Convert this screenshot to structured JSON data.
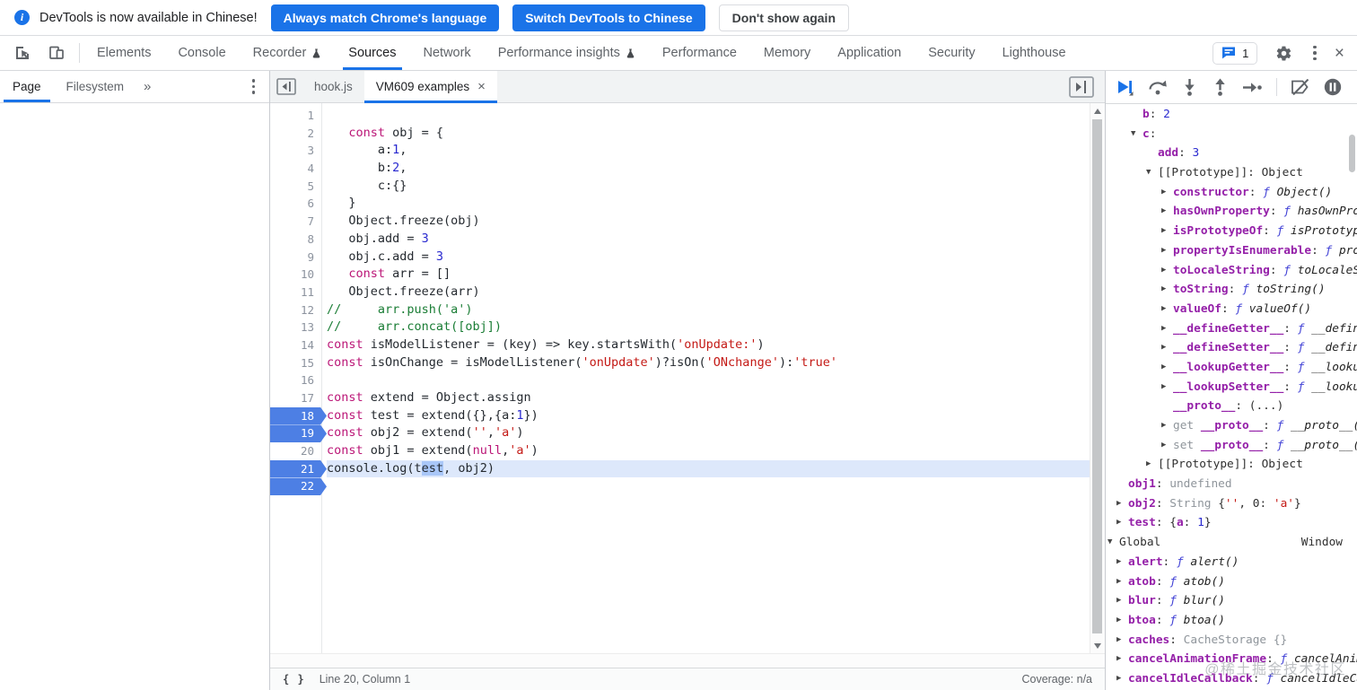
{
  "colors": {
    "accent": "#1a73e8",
    "breakpoint": "#4d7fe4",
    "keyword": "#bb1677",
    "number": "#2828cf",
    "string": "#c41a16",
    "comment": "#1a7d35",
    "property": "#941fa8",
    "current_line": "#dde8fb",
    "selection": "#a9c7f8",
    "icon_gray": "#5f6368"
  },
  "banner": {
    "message": "DevTools is now available in Chinese!",
    "buttons": [
      "Always match Chrome's language",
      "Switch DevTools to Chinese",
      "Don't show again"
    ]
  },
  "main_toolbar": {
    "tabs": [
      {
        "label": "Elements"
      },
      {
        "label": "Console"
      },
      {
        "label": "Recorder",
        "flask": true
      },
      {
        "label": "Sources",
        "active": true
      },
      {
        "label": "Network"
      },
      {
        "label": "Performance insights",
        "flask": true
      },
      {
        "label": "Performance"
      },
      {
        "label": "Memory"
      },
      {
        "label": "Application"
      },
      {
        "label": "Security"
      },
      {
        "label": "Lighthouse"
      }
    ],
    "issues_count": "1"
  },
  "navigator": {
    "tabs": [
      {
        "label": "Page",
        "active": true
      },
      {
        "label": "Filesystem"
      }
    ],
    "more_symbol": "»"
  },
  "editor": {
    "tabs": [
      {
        "label": "hook.js"
      },
      {
        "label": "VM609 examples",
        "active": true,
        "closable": true
      }
    ],
    "breakpoint_lines": [
      18,
      19,
      21,
      22
    ],
    "current_line": 21,
    "lines": [
      [],
      [
        [
          "d",
          "   "
        ],
        [
          "k",
          "const"
        ],
        [
          "d",
          " obj = {"
        ]
      ],
      [
        [
          "d",
          "       a:"
        ],
        [
          "n",
          "1"
        ],
        [
          "d",
          ","
        ]
      ],
      [
        [
          "d",
          "       b:"
        ],
        [
          "n",
          "2"
        ],
        [
          "d",
          ","
        ]
      ],
      [
        [
          "d",
          "       c:{}"
        ]
      ],
      [
        [
          "d",
          "   }"
        ]
      ],
      [
        [
          "d",
          "   Object.freeze(obj)"
        ]
      ],
      [
        [
          "d",
          "   obj.add = "
        ],
        [
          "n",
          "3"
        ]
      ],
      [
        [
          "d",
          "   obj.c.add = "
        ],
        [
          "n",
          "3"
        ]
      ],
      [
        [
          "d",
          "   "
        ],
        [
          "k",
          "const"
        ],
        [
          "d",
          " arr = []"
        ]
      ],
      [
        [
          "d",
          "   Object.freeze(arr)"
        ]
      ],
      [
        [
          "c",
          "//     arr.push('a')"
        ]
      ],
      [
        [
          "c",
          "//     arr.concat([obj])"
        ]
      ],
      [
        [
          "k",
          "const"
        ],
        [
          "d",
          " isModelListener = (key) => key.startsWith("
        ],
        [
          "s",
          "'onUpdate:'"
        ],
        [
          "d",
          ")"
        ]
      ],
      [
        [
          "k",
          "const"
        ],
        [
          "d",
          " isOnChange = isModelListener("
        ],
        [
          "s",
          "'onUpdate'"
        ],
        [
          "d",
          ")?isOn("
        ],
        [
          "s",
          "'ONchange'"
        ],
        [
          "d",
          "):"
        ],
        [
          "s",
          "'true'"
        ]
      ],
      [],
      [
        [
          "k",
          "const"
        ],
        [
          "d",
          " extend = Object.assign"
        ]
      ],
      [
        [
          "k",
          "const"
        ],
        [
          "d",
          " test = extend({},{a:"
        ],
        [
          "n",
          "1"
        ],
        [
          "d",
          "})"
        ]
      ],
      [
        [
          "k",
          "const"
        ],
        [
          "d",
          " obj2 = extend("
        ],
        [
          "s",
          "''"
        ],
        [
          "d",
          ","
        ],
        [
          "s",
          "'a'"
        ],
        [
          "d",
          ")"
        ]
      ],
      [
        [
          "k",
          "const"
        ],
        [
          "d",
          " obj1 = extend("
        ],
        [
          "k",
          "null"
        ],
        [
          "d",
          ","
        ],
        [
          "s",
          "'a'"
        ],
        [
          "d",
          ")"
        ]
      ],
      [
        [
          "d",
          "console.log(t"
        ],
        [
          "x",
          "est"
        ],
        [
          "d",
          ", obj2)"
        ]
      ],
      []
    ],
    "status": {
      "pretty_print": "{ }",
      "position": "Line 20, Column 1",
      "coverage": "Coverage: n/a"
    }
  },
  "scope_pane": {
    "rows": [
      {
        "l": 2,
        "a": "",
        "s": [
          [
            "p",
            "b"
          ],
          [
            "t",
            ": "
          ],
          [
            "n",
            "2"
          ]
        ]
      },
      {
        "l": 2,
        "a": "d",
        "s": [
          [
            "p",
            "c"
          ],
          [
            "t",
            ":"
          ]
        ]
      },
      {
        "l": 3,
        "a": "",
        "s": [
          [
            "p",
            "add"
          ],
          [
            "t",
            ": "
          ],
          [
            "n",
            "3"
          ]
        ]
      },
      {
        "l": 3,
        "a": "d",
        "s": [
          [
            "t",
            "[[Prototype]]: Object"
          ]
        ]
      },
      {
        "l": 4,
        "a": "r",
        "s": [
          [
            "p",
            "constructor"
          ],
          [
            "t",
            ": "
          ],
          [
            "f",
            "ƒ Object()"
          ]
        ]
      },
      {
        "l": 4,
        "a": "r",
        "s": [
          [
            "p",
            "hasOwnProperty"
          ],
          [
            "t",
            ": "
          ],
          [
            "f",
            "ƒ hasOwnProperty()"
          ]
        ]
      },
      {
        "l": 4,
        "a": "r",
        "s": [
          [
            "p",
            "isPrototypeOf"
          ],
          [
            "t",
            ": "
          ],
          [
            "f",
            "ƒ isPrototypeOf()"
          ]
        ]
      },
      {
        "l": 4,
        "a": "r",
        "s": [
          [
            "p",
            "propertyIsEnumerable"
          ],
          [
            "t",
            ": "
          ],
          [
            "f",
            "ƒ propertyIsEnumerable()"
          ]
        ]
      },
      {
        "l": 4,
        "a": "r",
        "s": [
          [
            "p",
            "toLocaleString"
          ],
          [
            "t",
            ": "
          ],
          [
            "f",
            "ƒ toLocaleString()"
          ]
        ]
      },
      {
        "l": 4,
        "a": "r",
        "s": [
          [
            "p",
            "toString"
          ],
          [
            "t",
            ": "
          ],
          [
            "f",
            "ƒ toString()"
          ]
        ]
      },
      {
        "l": 4,
        "a": "r",
        "s": [
          [
            "p",
            "valueOf"
          ],
          [
            "t",
            ": "
          ],
          [
            "f",
            "ƒ valueOf()"
          ]
        ]
      },
      {
        "l": 4,
        "a": "r",
        "s": [
          [
            "p",
            "__defineGetter__"
          ],
          [
            "t",
            ": "
          ],
          [
            "f",
            "ƒ __defineGetter__()"
          ]
        ]
      },
      {
        "l": 4,
        "a": "r",
        "s": [
          [
            "p",
            "__defineSetter__"
          ],
          [
            "t",
            ": "
          ],
          [
            "f",
            "ƒ __defineSetter__()"
          ]
        ]
      },
      {
        "l": 4,
        "a": "r",
        "s": [
          [
            "p",
            "__lookupGetter__"
          ],
          [
            "t",
            ": "
          ],
          [
            "f",
            "ƒ __lookupGetter__()"
          ]
        ]
      },
      {
        "l": 4,
        "a": "r",
        "s": [
          [
            "p",
            "__lookupSetter__"
          ],
          [
            "t",
            ": "
          ],
          [
            "f",
            "ƒ __lookupSetter__()"
          ]
        ]
      },
      {
        "l": 4,
        "a": "",
        "s": [
          [
            "p",
            "__proto__"
          ],
          [
            "t",
            ": (...)"
          ]
        ]
      },
      {
        "l": 4,
        "a": "r",
        "s": [
          [
            "g",
            "get "
          ],
          [
            "p",
            "__proto__"
          ],
          [
            "t",
            ": "
          ],
          [
            "f",
            "ƒ __proto__()"
          ]
        ]
      },
      {
        "l": 4,
        "a": "r",
        "s": [
          [
            "g",
            "set "
          ],
          [
            "p",
            "__proto__"
          ],
          [
            "t",
            ": "
          ],
          [
            "f",
            "ƒ __proto__()"
          ]
        ]
      },
      {
        "l": 3,
        "a": "r",
        "s": [
          [
            "t",
            "[[Prototype]]: Object"
          ]
        ]
      },
      {
        "l": 1,
        "a": "",
        "s": [
          [
            "p",
            "obj1"
          ],
          [
            "t",
            ": "
          ],
          [
            "g",
            "undefined"
          ]
        ]
      },
      {
        "l": 1,
        "a": "r",
        "s": [
          [
            "p",
            "obj2"
          ],
          [
            "t",
            ": "
          ],
          [
            "g",
            "String "
          ],
          [
            "t",
            "{"
          ],
          [
            "ss",
            "''"
          ],
          [
            "t",
            ", 0: "
          ],
          [
            "ss",
            "'a'"
          ],
          [
            "t",
            "}"
          ]
        ]
      },
      {
        "l": 1,
        "a": "r",
        "s": [
          [
            "p",
            "test"
          ],
          [
            "t",
            ": {"
          ],
          [
            "p",
            "a"
          ],
          [
            "t",
            ": "
          ],
          [
            "n",
            "1"
          ],
          [
            "t",
            "}"
          ]
        ]
      },
      {
        "l": 0,
        "a": "d",
        "s": [
          [
            "t",
            "Global"
          ]
        ],
        "r": "Window"
      },
      {
        "l": 1,
        "a": "r",
        "s": [
          [
            "p",
            "alert"
          ],
          [
            "t",
            ": "
          ],
          [
            "f",
            "ƒ alert()"
          ]
        ]
      },
      {
        "l": 1,
        "a": "r",
        "s": [
          [
            "p",
            "atob"
          ],
          [
            "t",
            ": "
          ],
          [
            "f",
            "ƒ atob()"
          ]
        ]
      },
      {
        "l": 1,
        "a": "r",
        "s": [
          [
            "p",
            "blur"
          ],
          [
            "t",
            ": "
          ],
          [
            "f",
            "ƒ blur()"
          ]
        ]
      },
      {
        "l": 1,
        "a": "r",
        "s": [
          [
            "p",
            "btoa"
          ],
          [
            "t",
            ": "
          ],
          [
            "f",
            "ƒ btoa()"
          ]
        ]
      },
      {
        "l": 1,
        "a": "r",
        "s": [
          [
            "p",
            "caches"
          ],
          [
            "t",
            ": "
          ],
          [
            "g",
            "CacheStorage {}"
          ]
        ]
      },
      {
        "l": 1,
        "a": "r",
        "s": [
          [
            "p",
            "cancelAnimationFrame"
          ],
          [
            "t",
            ": "
          ],
          [
            "f",
            "ƒ cancelAnimationFrame()"
          ]
        ]
      },
      {
        "l": 1,
        "a": "r",
        "s": [
          [
            "p",
            "cancelIdleCallback"
          ],
          [
            "t",
            ": "
          ],
          [
            "f",
            "ƒ cancelIdleCallback()"
          ]
        ]
      }
    ]
  },
  "watermark": "@稀土掘金技术社区"
}
